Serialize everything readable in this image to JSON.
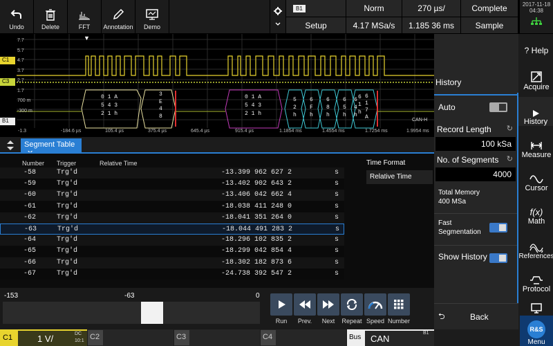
{
  "toolbar": {
    "undo": "Undo",
    "delete": "Delete",
    "fft": "FFT",
    "annotation": "Annotation",
    "demo": "Demo"
  },
  "header": {
    "bus_badge": "B1",
    "mode": "Norm",
    "time_div": "270 µs/",
    "status": "Complete",
    "setup": "Setup",
    "sample_rate": "4.17 MSa/s",
    "record_time": "1.185 36 ms",
    "acq_mode": "Sample",
    "date": "2017-11-18",
    "time": "04:38"
  },
  "scope": {
    "y_labels": [
      "7.7",
      "5.7",
      "4.7",
      "3.7",
      "2.7",
      "1.7",
      "700 m",
      "-300 m"
    ],
    "x_labels": [
      "-1.3",
      "-184.6 µs",
      "105.4 µs",
      "375.4 µs",
      "645.4 µs",
      "915.4 µs",
      "1.1854 ms",
      "1.4554 ms",
      "1.7254 ms",
      "1.9954 ms"
    ],
    "bus_label": "CAN-H",
    "ch_labels": [
      "C1",
      "C3",
      "B1"
    ],
    "decode": [
      [
        "0 1 A",
        "5 4 3",
        "2 1 h"
      ],
      [
        "3",
        "E",
        "4",
        "8"
      ],
      [
        "0 1 A",
        "5 4 3",
        "2 1 h"
      ],
      [
        "5",
        "2",
        "h"
      ],
      [
        "6",
        "F",
        "h"
      ],
      [
        "6",
        "8",
        "h"
      ],
      [
        "6",
        "5",
        "h"
      ],
      [
        "6",
        "4",
        "h"
      ],
      [
        "6",
        "1",
        "h"
      ],
      [
        "6",
        "1",
        "7",
        "A"
      ]
    ]
  },
  "segment_table": {
    "tab_label": "Segment Table",
    "col_number": "Number",
    "col_trigger": "Trigger",
    "col_time": "Relative Time",
    "rows": [
      {
        "number": "-58",
        "trigger": "Trg'd",
        "time": "-13.399 962 627 2",
        "unit": "s"
      },
      {
        "number": "-59",
        "trigger": "Trg'd",
        "time": "-13.402 902 643 2",
        "unit": "s"
      },
      {
        "number": "-60",
        "trigger": "Trg'd",
        "time": "-13.406 042 662 4",
        "unit": "s"
      },
      {
        "number": "-61",
        "trigger": "Trg'd",
        "time": "-18.038 411 248 0",
        "unit": "s"
      },
      {
        "number": "-62",
        "trigger": "Trg'd",
        "time": "-18.041 351 264 0",
        "unit": "s"
      },
      {
        "number": "-63",
        "trigger": "Trg'd",
        "time": "-18.044 491 283 2",
        "unit": "s"
      },
      {
        "number": "-64",
        "trigger": "Trg'd",
        "time": "-18.296 102 835 2",
        "unit": "s"
      },
      {
        "number": "-65",
        "trigger": "Trg'd",
        "time": "-18.299 042 854 4",
        "unit": "s"
      },
      {
        "number": "-66",
        "trigger": "Trg'd",
        "time": "-18.302 182 873 6",
        "unit": "s"
      },
      {
        "number": "-67",
        "trigger": "Trg'd",
        "time": "-24.738 392 547 2",
        "unit": "s"
      }
    ],
    "time_format_label": "Time Format",
    "time_format_value": "Relative Time"
  },
  "scrubber": {
    "left": "-153",
    "mid": "-63",
    "right": "0",
    "position": 0.59
  },
  "history_controls": {
    "run": "Run",
    "prev": "Prev.",
    "next": "Next",
    "repeat": "Repeat",
    "speed": "Speed",
    "number": "Number"
  },
  "history_panel": {
    "title": "History",
    "auto": "Auto",
    "record_length_label": "Record Length",
    "record_length": "100 kSa",
    "segments_label": "No. of Segments",
    "segments": "4000",
    "total_memory_label": "Total Memory",
    "total_memory": "400 MSa",
    "fast_seg_label1": "Fast",
    "fast_seg_label2": "Segmentation",
    "show_history": "Show History",
    "back": "Back"
  },
  "side_menu": {
    "help": "Help",
    "acquire": "Acquire",
    "history": "History",
    "measure": "Measure",
    "cursor": "Cursor",
    "math": "Math",
    "references": "References",
    "protocol": "Protocol",
    "menu": "Menu",
    "math_icon": "f(x)"
  },
  "bottom_bar": {
    "c1": "C1",
    "c1_scale": "1 V/",
    "c1_coupling": "DC",
    "c1_probe": "10:1",
    "c2": "C2",
    "c3": "C3",
    "c4": "C4",
    "bus": "Bus",
    "bus_type": "CAN",
    "bus_id": "B1"
  },
  "colors": {
    "c1": "#e8d42e",
    "c3": "#c7d43a",
    "accent": "#2a7fd4",
    "panel": "#262626"
  }
}
